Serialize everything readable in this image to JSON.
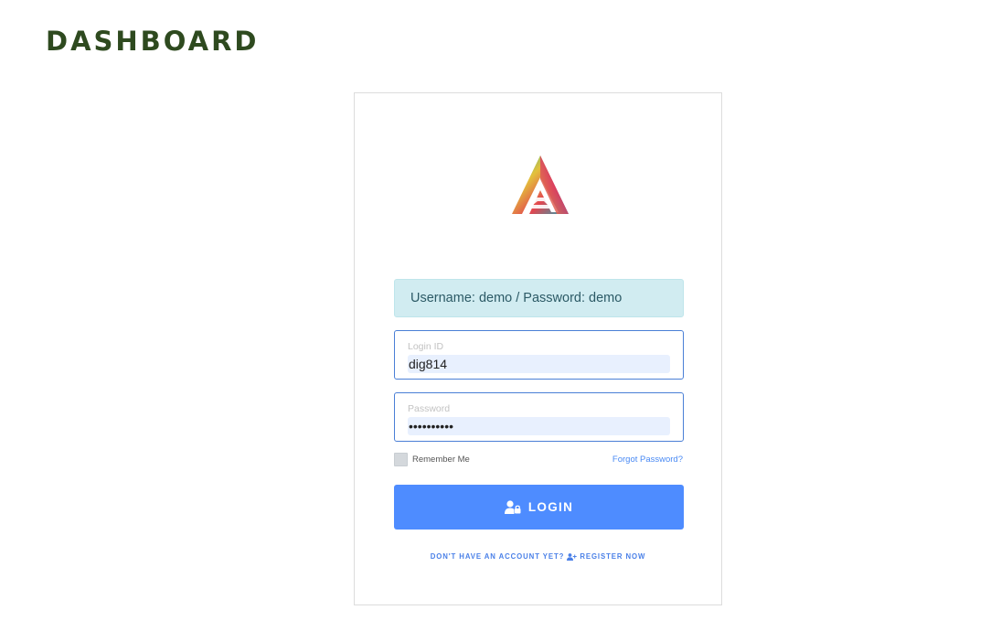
{
  "header": {
    "title": "DASHBOARD"
  },
  "login_card": {
    "alert_text": "Username: demo / Password: demo",
    "login_id": {
      "label": "Login ID",
      "value": "dig814"
    },
    "password": {
      "label": "Password",
      "value": "••••••••••"
    },
    "remember_label": "Remember Me",
    "forgot_label": "Forgot Password?",
    "login_button_label": "LOGIN",
    "register_prompt": "DON'T HAVE AN ACCOUNT YET?",
    "register_link": "REGISTER NOW"
  },
  "icons": {
    "logo": "triangle-logo",
    "login_button_icon": "user-lock-icon",
    "register_icon": "user-plus-icon"
  },
  "colors": {
    "title": "#2e4a1f",
    "alert_bg": "#d1ecf1",
    "field_border": "#4a7fd6",
    "button_bg": "#4e8cff",
    "link": "#4a8af4"
  }
}
